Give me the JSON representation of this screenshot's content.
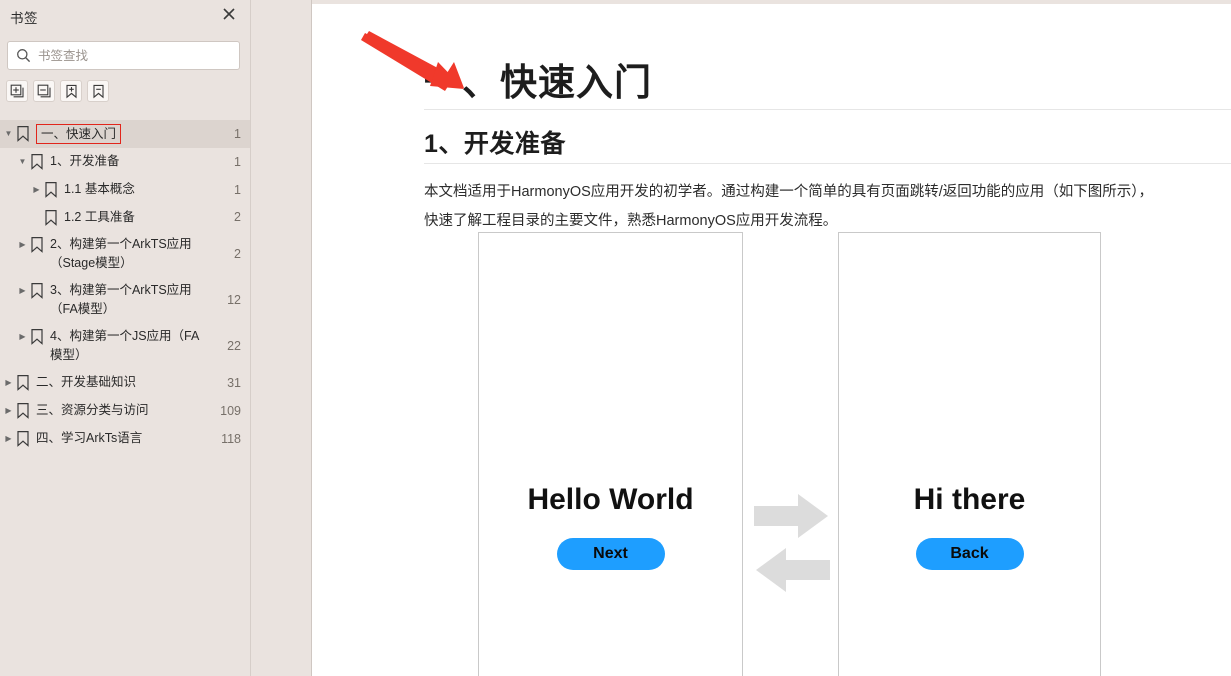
{
  "panel": {
    "title": "书签",
    "close_icon": "close-icon",
    "search": {
      "placeholder": "书签查找",
      "value": "",
      "icon": "search-icon"
    },
    "tools": [
      {
        "name": "expand-all-button",
        "icon": "box-plus-icon",
        "label": "+"
      },
      {
        "name": "collapse-all-button",
        "icon": "box-minus-icon",
        "label": "−"
      },
      {
        "name": "add-bookmark-button",
        "icon": "bookmark-plus-icon",
        "label": "+"
      },
      {
        "name": "remove-bookmark-button",
        "icon": "bookmark-minus-icon",
        "label": "−"
      }
    ],
    "tree": [
      {
        "label": "一、快速入门",
        "page": "1",
        "level": 0,
        "state": "expanded",
        "selected": true
      },
      {
        "label": "1、开发准备",
        "page": "1",
        "level": 1,
        "state": "expanded",
        "selected": false
      },
      {
        "label": "1.1 基本概念",
        "page": "1",
        "level": 2,
        "state": "collapsed",
        "selected": false
      },
      {
        "label": "1.2 工具准备",
        "page": "2",
        "level": 2,
        "state": "leaf",
        "selected": false
      },
      {
        "label": "2、构建第一个ArkTS应用（Stage模型）",
        "page": "2",
        "level": 1,
        "state": "collapsed",
        "selected": false
      },
      {
        "label": "3、构建第一个ArkTS应用（FA模型）",
        "page": "12",
        "level": 1,
        "state": "collapsed",
        "selected": false
      },
      {
        "label": "4、构建第一个JS应用（FA模型）",
        "page": "22",
        "level": 1,
        "state": "collapsed",
        "selected": false
      },
      {
        "label": "二、开发基础知识",
        "page": "31",
        "level": 0,
        "state": "collapsed",
        "selected": false
      },
      {
        "label": "三、资源分类与访问",
        "page": "109",
        "level": 0,
        "state": "collapsed",
        "selected": false
      },
      {
        "label": "四、学习ArkTs语言",
        "page": "118",
        "level": 0,
        "state": "collapsed",
        "selected": false
      }
    ]
  },
  "document": {
    "heading1": "一、快速入门",
    "heading2": "1、开发准备",
    "paragraph": "本文档适用于HarmonyOS应用开发的初学者。通过构建一个简单的具有页面跳转/返回功能的应用（如下图所示），快速了解工程目录的主要文件，熟悉HarmonyOS应用开发流程。",
    "figure": {
      "phone_left": {
        "title": "Hello World",
        "button": "Next"
      },
      "phone_right": {
        "title": "Hi there",
        "button": "Back"
      },
      "arrow_forward_icon": "arrow-right-icon",
      "arrow_back_icon": "arrow-left-icon"
    }
  },
  "annotation": {
    "arrow_icon": "red-arrow-annotation",
    "color": "#F0392B"
  },
  "colors": {
    "panel_background": "#EAE3DF",
    "selection": "#DCD4CF",
    "selection_outline": "#E1251B",
    "button_blue": "#1E9EFF",
    "arrow_gray": "#DDDDDD",
    "page_white": "#FFFFFF"
  }
}
